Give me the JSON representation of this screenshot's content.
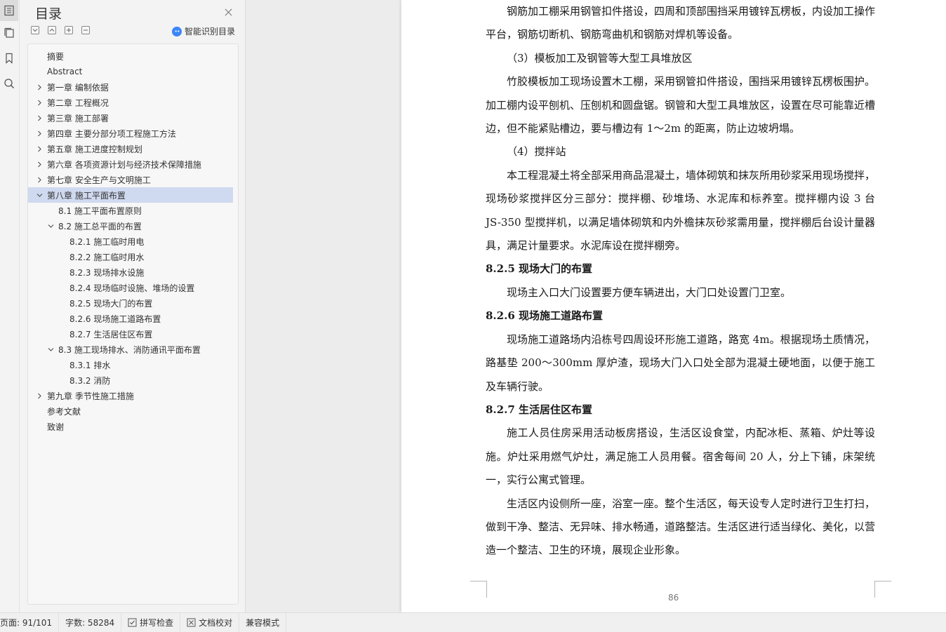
{
  "sidebar_strip": {
    "icons": [
      "toc-icon",
      "pages-icon",
      "bookmark-icon",
      "search-icon"
    ]
  },
  "toc": {
    "title": "目录",
    "smart_label": "智能识别目录",
    "items": [
      {
        "label": "摘要",
        "level": 1,
        "arrow": "none"
      },
      {
        "label": "Abstract",
        "level": 1,
        "arrow": "none"
      },
      {
        "label": "第一章  编制依据",
        "level": 1,
        "arrow": "right"
      },
      {
        "label": "第二章  工程概况",
        "level": 1,
        "arrow": "right"
      },
      {
        "label": "第三章  施工部署",
        "level": 1,
        "arrow": "right"
      },
      {
        "label": "第四章  主要分部分项工程施工方法",
        "level": 1,
        "arrow": "right"
      },
      {
        "label": "第五章  施工进度控制规划",
        "level": 1,
        "arrow": "right"
      },
      {
        "label": "第六章  各项资源计划与经济技术保障措施",
        "level": 1,
        "arrow": "right"
      },
      {
        "label": "第七章  安全生产与文明施工",
        "level": 1,
        "arrow": "right"
      },
      {
        "label": "第八章  施工平面布置",
        "level": 1,
        "arrow": "down",
        "selected": true
      },
      {
        "label": "8.1  施工平面布置原则",
        "level": 2,
        "arrow": "none"
      },
      {
        "label": "8.2  施工总平面的布置",
        "level": 2,
        "arrow": "down"
      },
      {
        "label": "8.2.1  施工临时用电",
        "level": 3,
        "arrow": "none"
      },
      {
        "label": "8.2.2  施工临时用水",
        "level": 3,
        "arrow": "none"
      },
      {
        "label": "8.2.3  现场排水设施",
        "level": 3,
        "arrow": "none"
      },
      {
        "label": "8.2.4  现场临时设施、堆场的设置",
        "level": 3,
        "arrow": "none"
      },
      {
        "label": "8.2.5  现场大门的布置",
        "level": 3,
        "arrow": "none"
      },
      {
        "label": "8.2.6  现场施工道路布置",
        "level": 3,
        "arrow": "none"
      },
      {
        "label": "8.2.7  生活居住区布置",
        "level": 3,
        "arrow": "none"
      },
      {
        "label": "8.3  施工现场排水、消防通讯平面布置",
        "level": 2,
        "arrow": "down"
      },
      {
        "label": "8.3.1  排水",
        "level": 3,
        "arrow": "none"
      },
      {
        "label": "8.3.2  消防",
        "level": 3,
        "arrow": "none"
      },
      {
        "label": "第九章  季节性施工措施",
        "level": 1,
        "arrow": "right"
      },
      {
        "label": "参考文献",
        "level": 1,
        "arrow": "none"
      },
      {
        "label": "致谢",
        "level": 1,
        "arrow": "none"
      }
    ]
  },
  "document": {
    "blocks": [
      {
        "type": "para",
        "text": "钢筋加工棚采用钢管扣件搭设，四周和顶部围挡采用镀锌瓦楞板，内设加工操作平台，钢筋切断机、钢筋弯曲机和钢筋对焊机等设备。"
      },
      {
        "type": "sub",
        "text": "（3）模板加工及钢管等大型工具堆放区"
      },
      {
        "type": "para",
        "text": "竹胶模板加工现场设置木工棚，采用钢管扣件搭设，围挡采用镀锌瓦楞板围护。加工棚内设平刨机、压刨机和圆盘锯。钢管和大型工具堆放区，设置在尽可能靠近槽边，但不能紧贴槽边，要与槽边有 1～2m 的距离，防止边坡坍塌。"
      },
      {
        "type": "sub",
        "text": "（4）搅拌站"
      },
      {
        "type": "para",
        "text": "本工程混凝土将全部采用商品混凝土，墙体砌筑和抹灰所用砂浆采用现场搅拌，现场砂浆搅拌区分三部分：搅拌棚、砂堆场、水泥库和标养室。搅拌棚内设 3 台 JS-350 型搅拌机，以满足墙体砌筑和内外檐抹灰砂浆需用量，搅拌棚后台设计量器具，满足计量要求。水泥库设在搅拌棚旁。"
      },
      {
        "type": "heading",
        "text": "8.2.5  现场大门的布置"
      },
      {
        "type": "para",
        "text": "现场主入口大门设置要方便车辆进出，大门口处设置门卫室。"
      },
      {
        "type": "heading",
        "text": "8.2.6  现场施工道路布置"
      },
      {
        "type": "para",
        "text": "现场施工道路场内沿栋号四周设环形施工道路，路宽 4m。根据现场土质情况，路基垫 200～300mm 厚炉渣，现场大门入口处全部为混凝土硬地面，以便于施工及车辆行驶。"
      },
      {
        "type": "heading",
        "text": "8.2.7  生活居住区布置"
      },
      {
        "type": "para",
        "text": "施工人员住房采用活动板房搭设，生活区设食堂，内配冰柜、蒸箱、炉灶等设施。炉灶采用燃气炉灶，满足施工人员用餐。宿舍每间 20 人，分上下铺，床架统一，实行公寓式管理。"
      },
      {
        "type": "para",
        "text": "生活区内设侧所一座，浴室一座。整个生活区，每天设专人定时进行卫生打扫，做到干净、整洁、无异味、排水畅通，道路整洁。生活区进行适当绿化、美化，以营造一个整洁、卫生的环境，展现企业形象。"
      }
    ],
    "page_number": "86"
  },
  "status_bar": {
    "page": "页面: 91/101",
    "words": "字数: 58284",
    "spell": "拼写检查",
    "proof": "文档校对",
    "compat": "兼容模式"
  }
}
